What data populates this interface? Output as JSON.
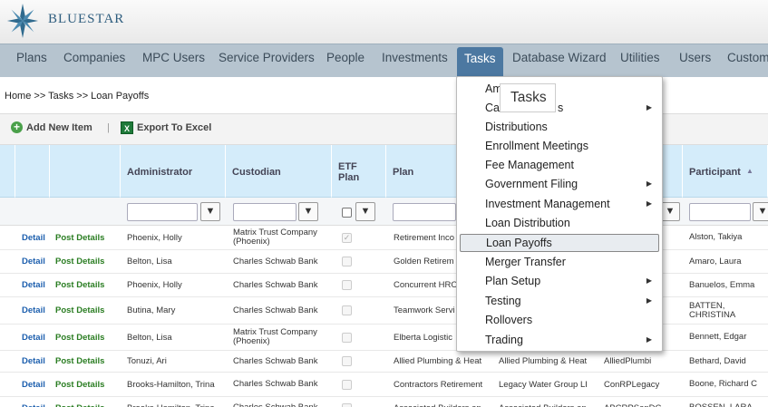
{
  "app": {
    "logo_text": "BlueStar"
  },
  "nav": [
    "Plans",
    "Companies",
    "MPC Users",
    "Service Providers",
    "People",
    "Investments",
    "Tasks",
    "Database Wizard",
    "Utilities",
    "Users",
    "Custom"
  ],
  "breadcrumb": "Home >> Tasks >> Loan Payoffs",
  "toolbar": {
    "add_label": "Add New Item",
    "separator": "|",
    "export_label": "Export To Excel",
    "excel_glyph": "X"
  },
  "grid": {
    "headers": {
      "administrator": "Administrator",
      "custodian": "Custodian",
      "etf": "ETF Plan",
      "plan": "Plan",
      "participant": "Participant"
    },
    "detail_label": "Detail",
    "post_label": "Post Details",
    "rows": [
      {
        "admin": "Phoenix, Holly",
        "custodian": "Matrix Trust Company (Phoenix)",
        "etf_checked": true,
        "plan": "Retirement Inco",
        "col7": "",
        "col8": "",
        "participant": "Alston, Takiya"
      },
      {
        "admin": "Belton, Lisa",
        "custodian": "Charles Schwab Bank",
        "etf_checked": false,
        "plan": "Golden Retirem",
        "col7": "",
        "col8": "",
        "participant": "Amaro, Laura"
      },
      {
        "admin": "Phoenix, Holly",
        "custodian": "Charles Schwab Bank",
        "etf_checked": false,
        "plan": "Concurrent HRO",
        "col7": "",
        "col8": "",
        "participant": "Banuelos, Emma"
      },
      {
        "admin": "Butina, Mary",
        "custodian": "Charles Schwab Bank",
        "etf_checked": false,
        "plan": "Teamwork Servi",
        "col7": "",
        "col8": "",
        "participant": "BATTEN, CHRISTINA"
      },
      {
        "admin": "Belton, Lisa",
        "custodian": "Matrix Trust Company (Phoenix)",
        "etf_checked": false,
        "plan": "Elberta Logistic",
        "col7": "",
        "col8": "",
        "participant": "Bennett, Edgar"
      },
      {
        "admin": "Tonuzi, Ari",
        "custodian": "Charles Schwab Bank",
        "etf_checked": false,
        "plan": "Allied Plumbing & Heat",
        "col7": "Allied Plumbing & Heat",
        "col8": "AlliedPlumbi",
        "participant": "Bethard, David"
      },
      {
        "admin": "Brooks-Hamilton, Trina",
        "custodian": "Charles Schwab Bank",
        "etf_checked": false,
        "plan": "Contractors Retirement",
        "col7": "Legacy Water Group LI",
        "col8": "ConRPLegacy",
        "participant": "Boone, Richard C"
      },
      {
        "admin": "Brooks-Hamilton, Trina",
        "custodian": "Charles Schwab Bank",
        "etf_checked": false,
        "plan": "Associated Builders an",
        "col7": "Associated Builders an",
        "col8": "ABCRPSanDC",
        "participant": "BOSSEN, LARA"
      }
    ]
  },
  "menu": {
    "tooltip": "Tasks",
    "items": [
      {
        "label": "Am",
        "submenu": false
      },
      {
        "label": "Cas",
        "suffix": "s",
        "submenu": true
      },
      {
        "label": "Distributions",
        "submenu": false
      },
      {
        "label": "Enrollment Meetings",
        "submenu": false
      },
      {
        "label": "Fee Management",
        "submenu": false
      },
      {
        "label": "Government Filing",
        "submenu": true
      },
      {
        "label": "Investment Management",
        "submenu": true
      },
      {
        "label": "Loan Distribution",
        "submenu": false
      },
      {
        "label": "Loan Payoffs",
        "submenu": false,
        "highlighted": true
      },
      {
        "label": "Merger Transfer",
        "submenu": false
      },
      {
        "label": "Plan Setup",
        "submenu": true
      },
      {
        "label": "Testing",
        "submenu": true
      },
      {
        "label": "Rollovers",
        "submenu": false
      },
      {
        "label": "Trading",
        "submenu": true
      }
    ]
  },
  "colors": {
    "nav_bg": "#b6c4cf",
    "nav_active": "#4c78a1",
    "header_bg": "#d4ecfa",
    "detail": "#1d5fae",
    "post": "#2a7d22"
  }
}
